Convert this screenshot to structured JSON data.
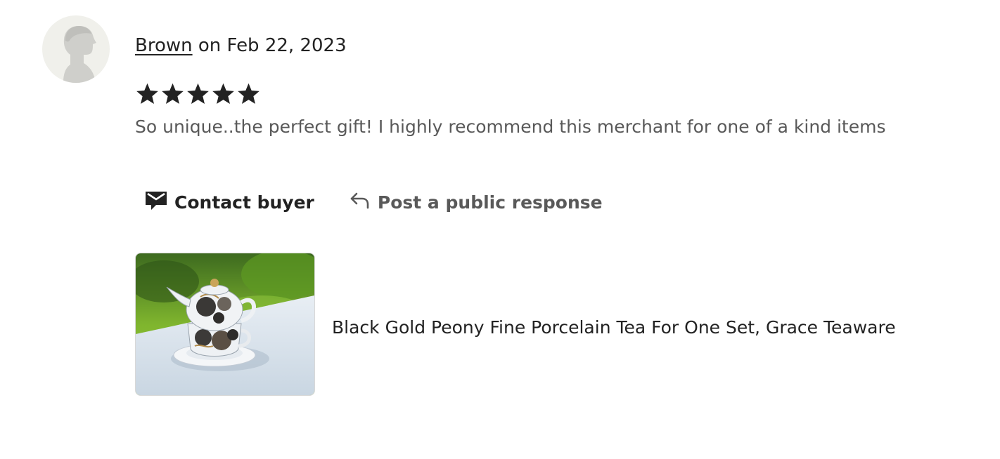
{
  "review": {
    "reviewer_name": "Brown",
    "date_prefix": " on ",
    "date": "Feb 22, 2023",
    "rating": 5,
    "text": "So unique..the perfect gift! I highly recommend this merchant for one of a kind items"
  },
  "actions": {
    "contact_label": "Contact buyer",
    "respond_label": "Post a public response"
  },
  "product": {
    "title": "Black Gold Peony Fine Porcelain Tea For One Set, Grace Teaware"
  },
  "icons": {
    "avatar": "person-silhouette-icon",
    "star": "star-icon",
    "contact": "envelope-icon",
    "respond": "reply-arrow-icon"
  },
  "colors": {
    "text_primary": "#222222",
    "text_secondary": "#595959",
    "avatar_bg": "#f0f0eb"
  }
}
